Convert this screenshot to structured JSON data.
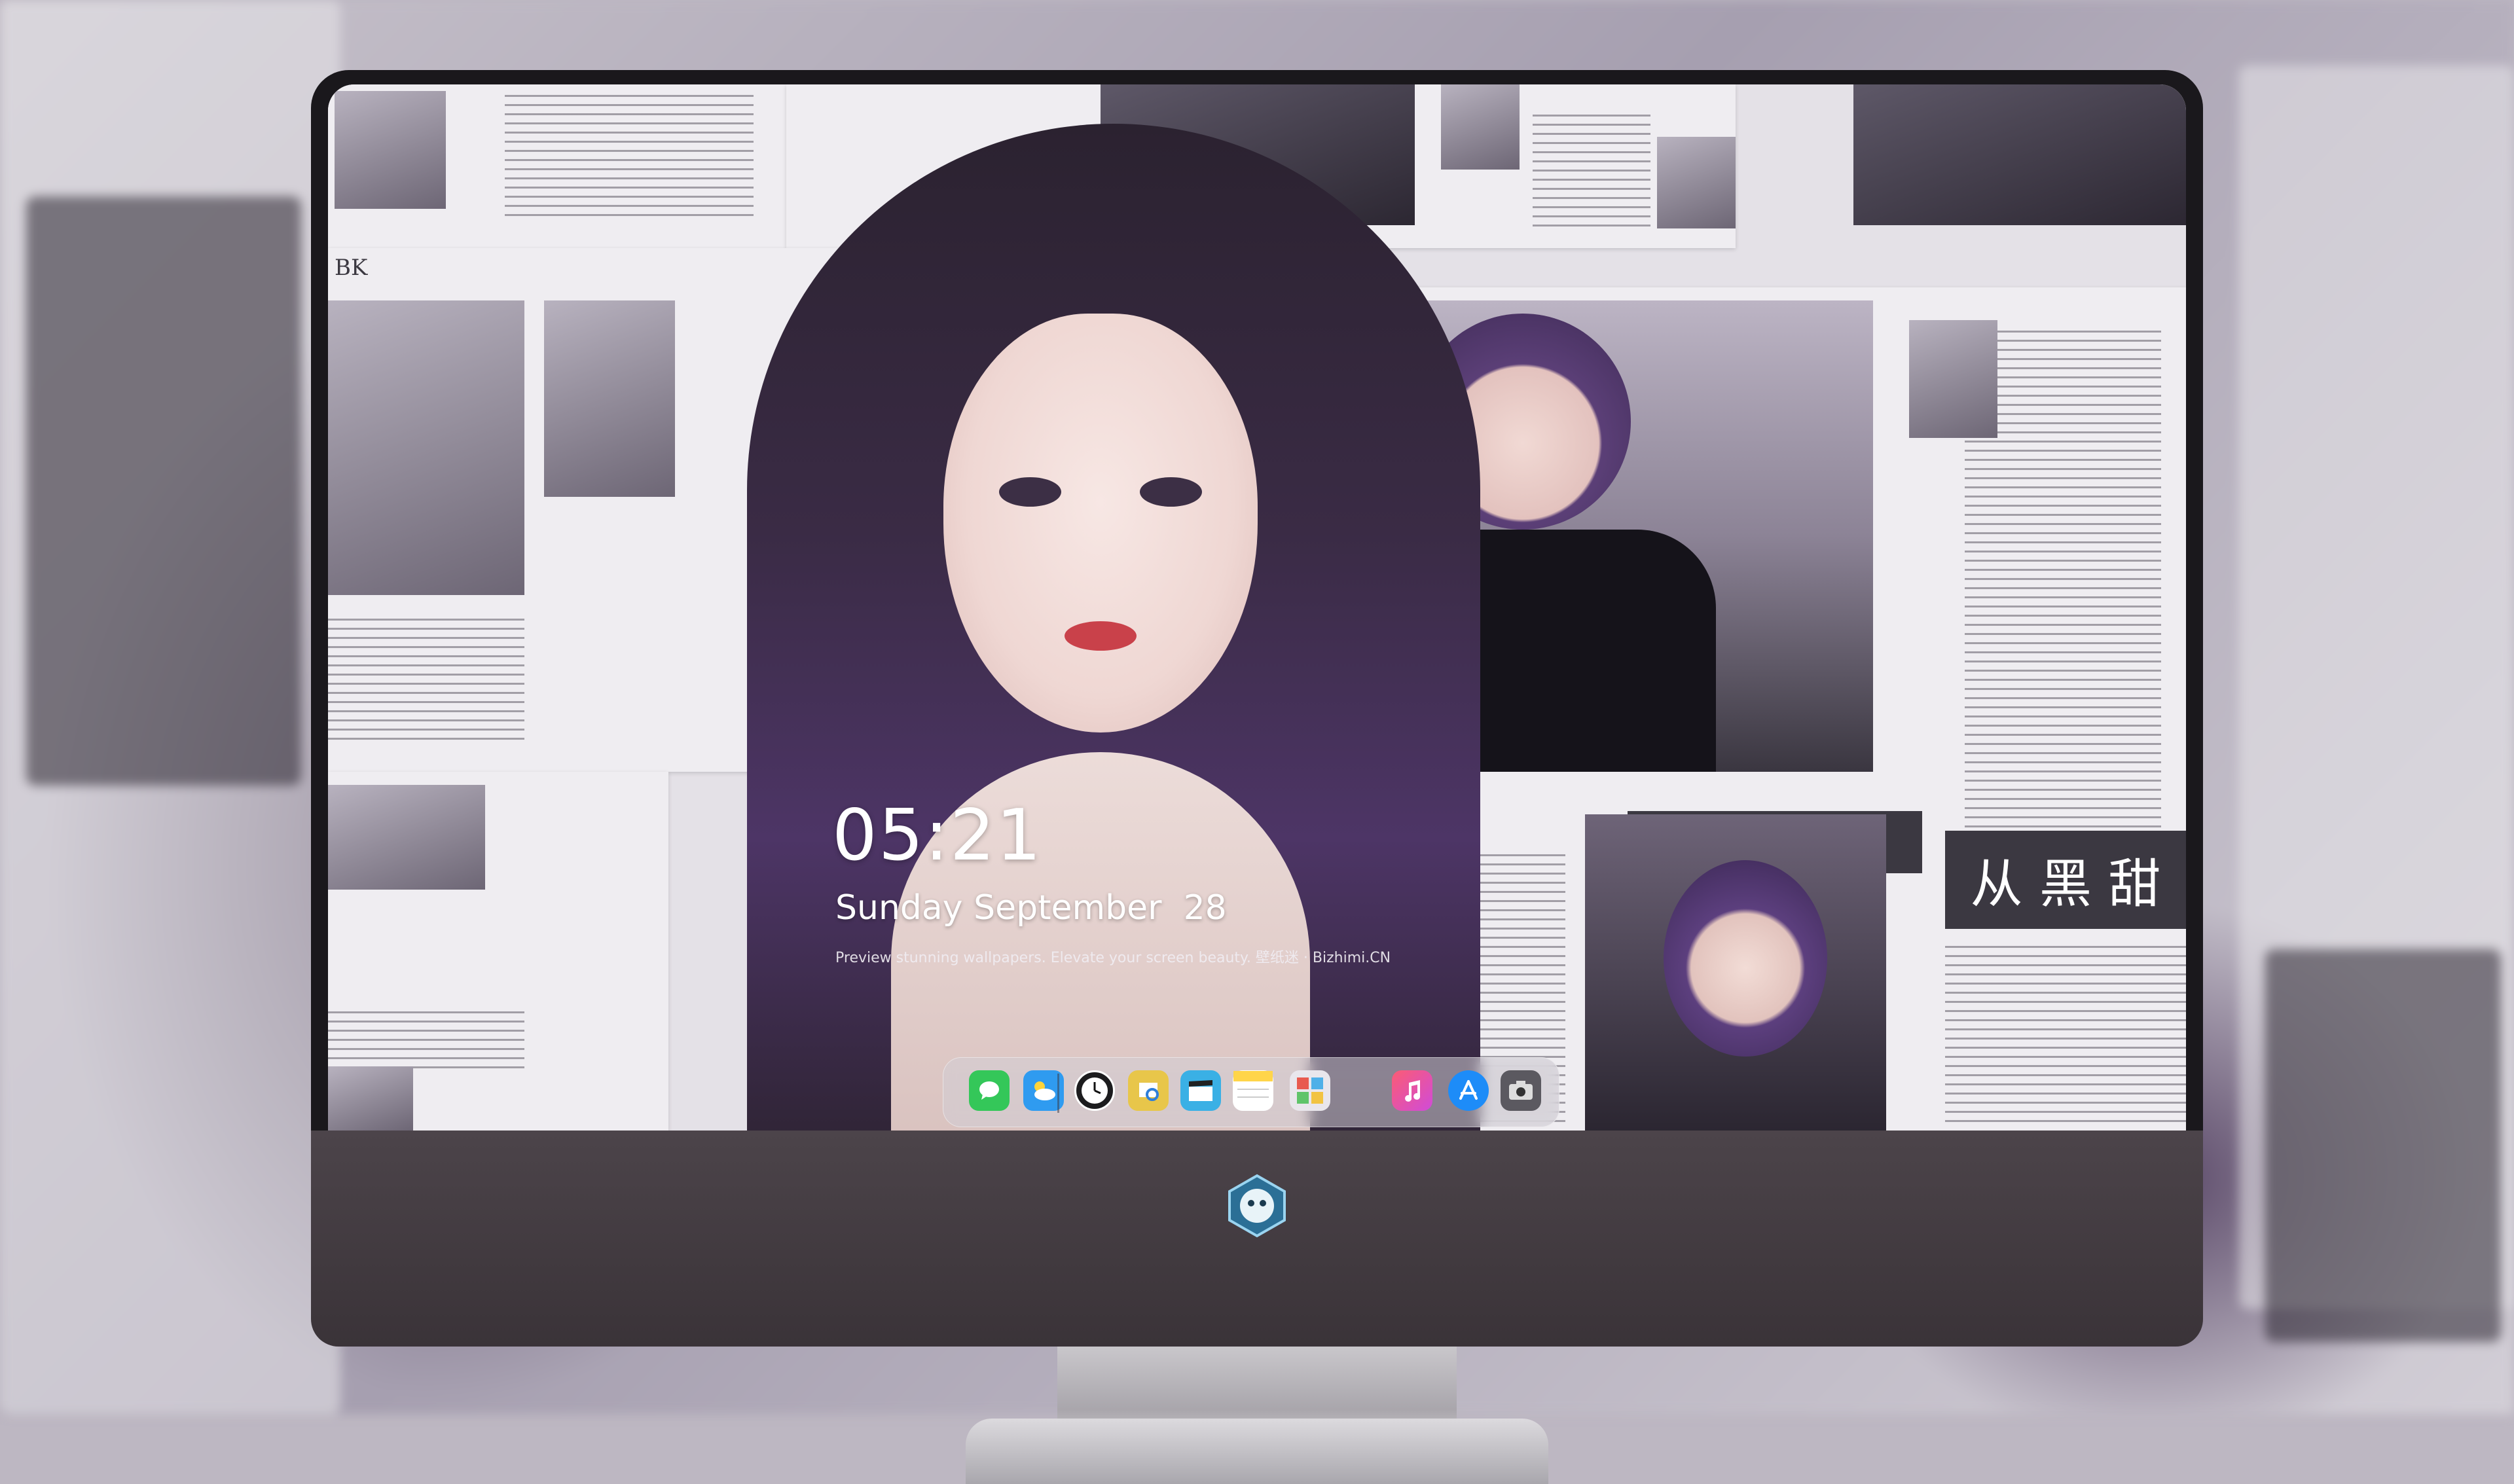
{
  "lock_screen": {
    "time": "05:21",
    "date": "Sunday September  28",
    "tagline": "Preview stunning wallpapers. Elevate your screen beauty. 壁纸迷 · Bizhimi.CN"
  },
  "dock": {
    "apps": [
      {
        "name": "messages-icon",
        "color": "#34c759"
      },
      {
        "name": "weather-icon",
        "color": "#2f9bf0"
      },
      {
        "name": "clock-icon",
        "color": "#1c1c1e"
      },
      {
        "name": "preview-icon",
        "color": "#e8c64a"
      },
      {
        "name": "clips-icon",
        "color": "#3ab0e5"
      },
      {
        "name": "notes-icon",
        "color": "#ffd54a"
      },
      {
        "name": "photo-booth-icon",
        "color": "#e9e6ec"
      },
      {
        "name": "music-icon",
        "color": "#f55e8a"
      },
      {
        "name": "app-store-icon",
        "color": "#1d8cf8"
      },
      {
        "name": "screenshot-icon",
        "color": "#5b5960"
      }
    ]
  },
  "wallpaper": {
    "headline_text": "从 黑 甜",
    "corner_text": "BK"
  }
}
